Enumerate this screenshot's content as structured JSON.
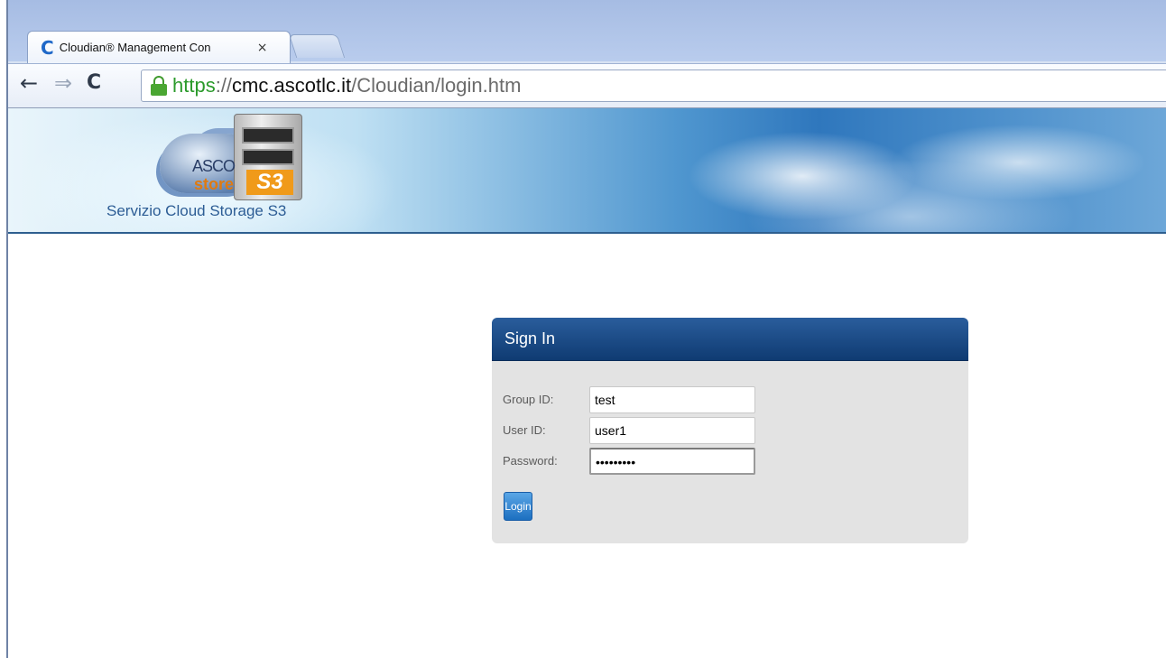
{
  "browser": {
    "tab_title": "Cloudian® Management Con",
    "tab_close": "×",
    "tab_favicon": "C",
    "url": {
      "scheme": "https",
      "separator": "://",
      "host": "cmc.ascotlc.it",
      "path": "/Cloudian/login.htm"
    },
    "icons": {
      "back": "←",
      "forward": "⇒",
      "reload": "C"
    }
  },
  "banner": {
    "logo_asco": "ASCO",
    "logo_store": "store",
    "logo_s3": "S3",
    "caption": "Servizio Cloud Storage S3"
  },
  "signin": {
    "title": "Sign In",
    "fields": {
      "group_id": {
        "label": "Group ID:",
        "value": "test"
      },
      "user_id": {
        "label": "User ID:",
        "value": "user1"
      },
      "password": {
        "label": "Password:",
        "value": "•••••••••"
      }
    },
    "login_label": "Login"
  },
  "colors": {
    "header_blue": "#0f3b72",
    "panel_gray": "#e3e3e3",
    "button_blue": "#1c6fc0",
    "secure_green": "#2b9a2b"
  }
}
